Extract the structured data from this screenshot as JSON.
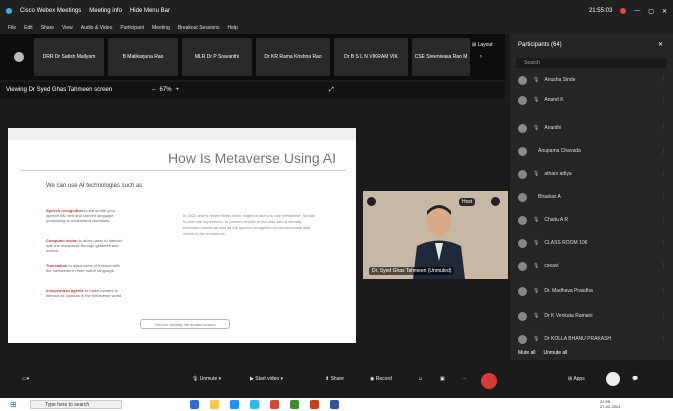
{
  "titlebar": {
    "app": "Cisco Webex Meetings",
    "meeting_info": "Meeting info",
    "hide_menu": "Hide Menu Bar",
    "time": "21:55:03"
  },
  "menubar": [
    "File",
    "Edit",
    "Share",
    "View",
    "Audio & Video",
    "Participant",
    "Meeting",
    "Breakout Sessions",
    "Help"
  ],
  "strip": {
    "tiles": [
      "DRR Dr Satish Mallyam",
      "B Malikarjuna Rao",
      "MLR Dr P Sravanthi",
      "Dr KR Rama Krishna Rao",
      "Dr B S L N VIKRAM VIK",
      "CSE Sreenivasa Rao M"
    ],
    "layout_label": "Layout"
  },
  "viewing": {
    "label": "Viewing Dr Syed Ghas Tahmeen screen",
    "zoom": "67%"
  },
  "slide": {
    "title": "How Is Metaverse Using AI",
    "subhead": "We can use AI technologies such as",
    "bullets": [
      {
        "term": "Speech recognition",
        "text": "to transcribe your speech into text and convert language processing to understand intentions."
      },
      {
        "term": "Computer vision",
        "text": "to allow users to interact with the metaverse through gestures and motion."
      },
      {
        "term": "Translation",
        "text": "to allow users to interact with the metaverse in their native language."
      },
      {
        "term": "Independent agents",
        "text": "to make avatars to interact as humans in the metaverse world."
      }
    ],
    "paragraph": "In 2022 and in recent times there might be users to use metaverse. Similar to one real experience, to present results to the user with a virtually embodied model as well as the speech recognition to communicate with others in the metaverse.",
    "zoom_bar": "You are viewing the shared screen"
  },
  "video": {
    "label": "Dr. Syed Ghas Tahmeen (Unmuted)",
    "host": "Host"
  },
  "participants": {
    "header": "Participants (64)",
    "search": "Search",
    "rows": [
      {
        "name": "Anusha Sinde"
      },
      {
        "name": "Anand K"
      },
      {
        "name": "Ananthi"
      },
      {
        "name": "Anupama Chavada"
      },
      {
        "name": "atharv adiya"
      },
      {
        "name": "Bhaskar A"
      },
      {
        "name": "Chaitu A R"
      },
      {
        "name": "CLASS ROOM 106"
      },
      {
        "name": "cseavi"
      },
      {
        "name": "Dr. Madhava Prasdha"
      },
      {
        "name": "Dr K Venkata Ramani"
      },
      {
        "name": "Dr KOLLA BHANU PRAKASH"
      }
    ],
    "mute_all": "Mute all",
    "unmute_all": "Unmute all"
  },
  "toolbar": {
    "unmute": "Unmute",
    "start_video": "Start video",
    "share": "Share",
    "record": "Record",
    "apps": "Apps"
  },
  "taskbar": {
    "search": "Type here to search",
    "time": "21:55",
    "date": "27-02-2024"
  }
}
